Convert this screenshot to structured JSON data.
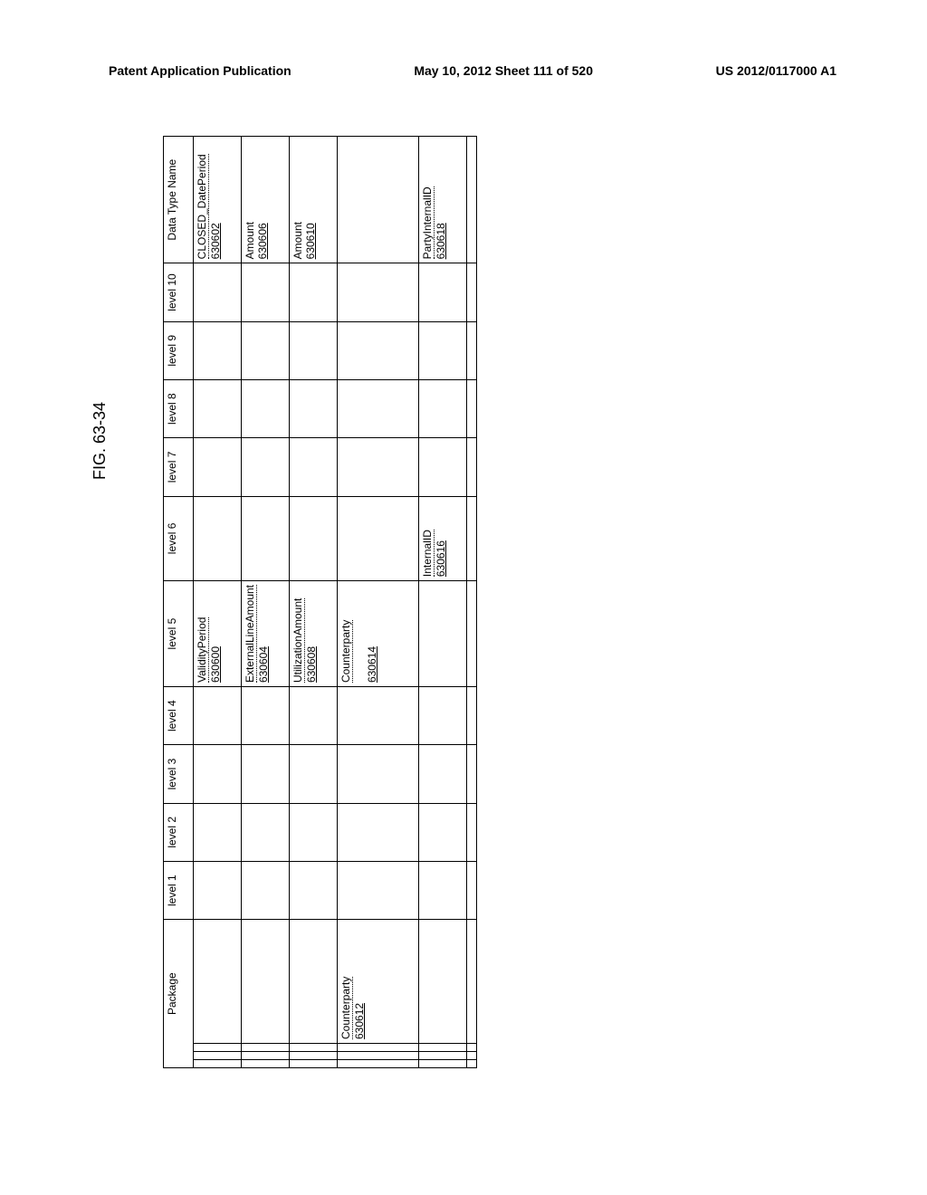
{
  "header": {
    "left": "Patent Application Publication",
    "middle": "May 10, 2012  Sheet 111 of 520",
    "right": "US 2012/0117000 A1"
  },
  "figure_label": "FIG. 63-34",
  "columns": {
    "package": "Package",
    "level1": "level 1",
    "level2": "level 2",
    "level3": "level 3",
    "level4": "level 4",
    "level5": "level 5",
    "level6": "level 6",
    "level7": "level 7",
    "level8": "level 8",
    "level9": "level 9",
    "level10": "level 10",
    "datatype": "Data Type Name"
  },
  "rows": [
    {
      "package": "",
      "level5": "ValidityPeriod",
      "level5_num": "630600",
      "datatype": "CLOSED_DatePeriod",
      "datatype_num": "630602"
    },
    {
      "package": "",
      "level5": "ExternalLineAmount",
      "level5_num": "630604",
      "datatype": "Amount",
      "datatype_num": "630606"
    },
    {
      "package": "",
      "level5": "UtilizationAmount",
      "level5_num": "630608",
      "datatype": "Amount",
      "datatype_num": "630610"
    },
    {
      "package": "Counterparty",
      "package_num": "630612",
      "level5": "Counterparty",
      "level5_num": "630614",
      "datatype": "",
      "datatype_num": ""
    },
    {
      "package": "",
      "level6": "InternalID",
      "level6_num": "630616",
      "datatype": "PartyInternalID",
      "datatype_num": "630618"
    }
  ]
}
